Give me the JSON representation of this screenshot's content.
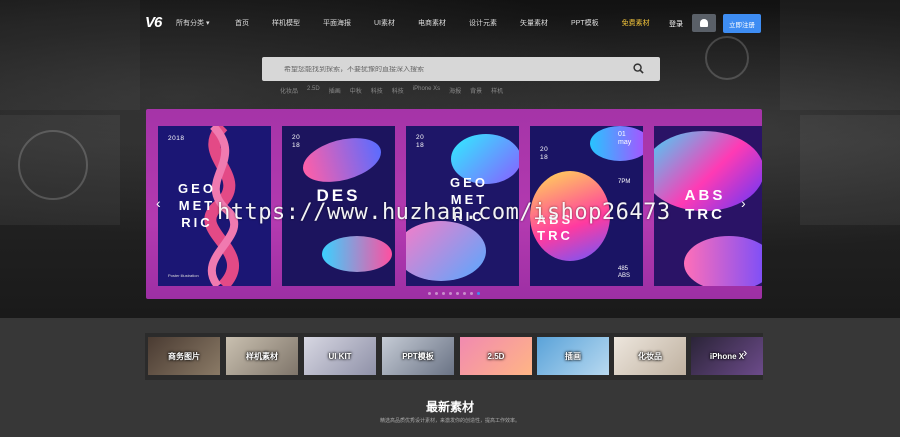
{
  "header": {
    "logo": "V6",
    "category_toggle": "所有分类",
    "nav": [
      "首页",
      "样机模型",
      "平面海报",
      "UI素材",
      "电商素材",
      "设计元素",
      "矢量素材",
      "PPT模板",
      "免费素材"
    ],
    "nav_active_index": 8,
    "login": "登录",
    "register": "立即注册",
    "accent_color": "#3e8df3",
    "highlight_color": "#f5c63b"
  },
  "search": {
    "placeholder": "希望您能找到探索，不要犹豫的直接深入搜索",
    "hotwords": [
      "化妆品",
      "2.5D",
      "插画",
      "中秋",
      "科技",
      "科技",
      "iPhone Xs",
      "海报",
      "背景",
      "样机"
    ]
  },
  "carousel": {
    "cards": [
      {
        "top": "2018",
        "title": "GEO MET RIC",
        "footer": "Poster illustration"
      },
      {
        "top": "20 18",
        "title": "DES",
        "footer": ""
      },
      {
        "top": "20 18",
        "title": "GEO MET RIC",
        "footer": ""
      },
      {
        "top": "20 18",
        "title": "ABS TRC",
        "date": "01 may",
        "time": "7PM",
        "footer": "485 ABS"
      },
      {
        "top": "",
        "title": "ABS TRC",
        "footer": ""
      }
    ],
    "dot_count": 8,
    "active_dot": 7
  },
  "watermark": "https://www.huzhan.com/ishop26473",
  "categories": [
    "商务图片",
    "样机素材",
    "UI KIT",
    "PPT模板",
    "2.5D",
    "插画",
    "化妆品",
    "iPhone X"
  ],
  "section": {
    "title": "最新素材",
    "subtitle": "精选高品质优秀设计素材，来激发你的创造性，提高工作效率。"
  }
}
